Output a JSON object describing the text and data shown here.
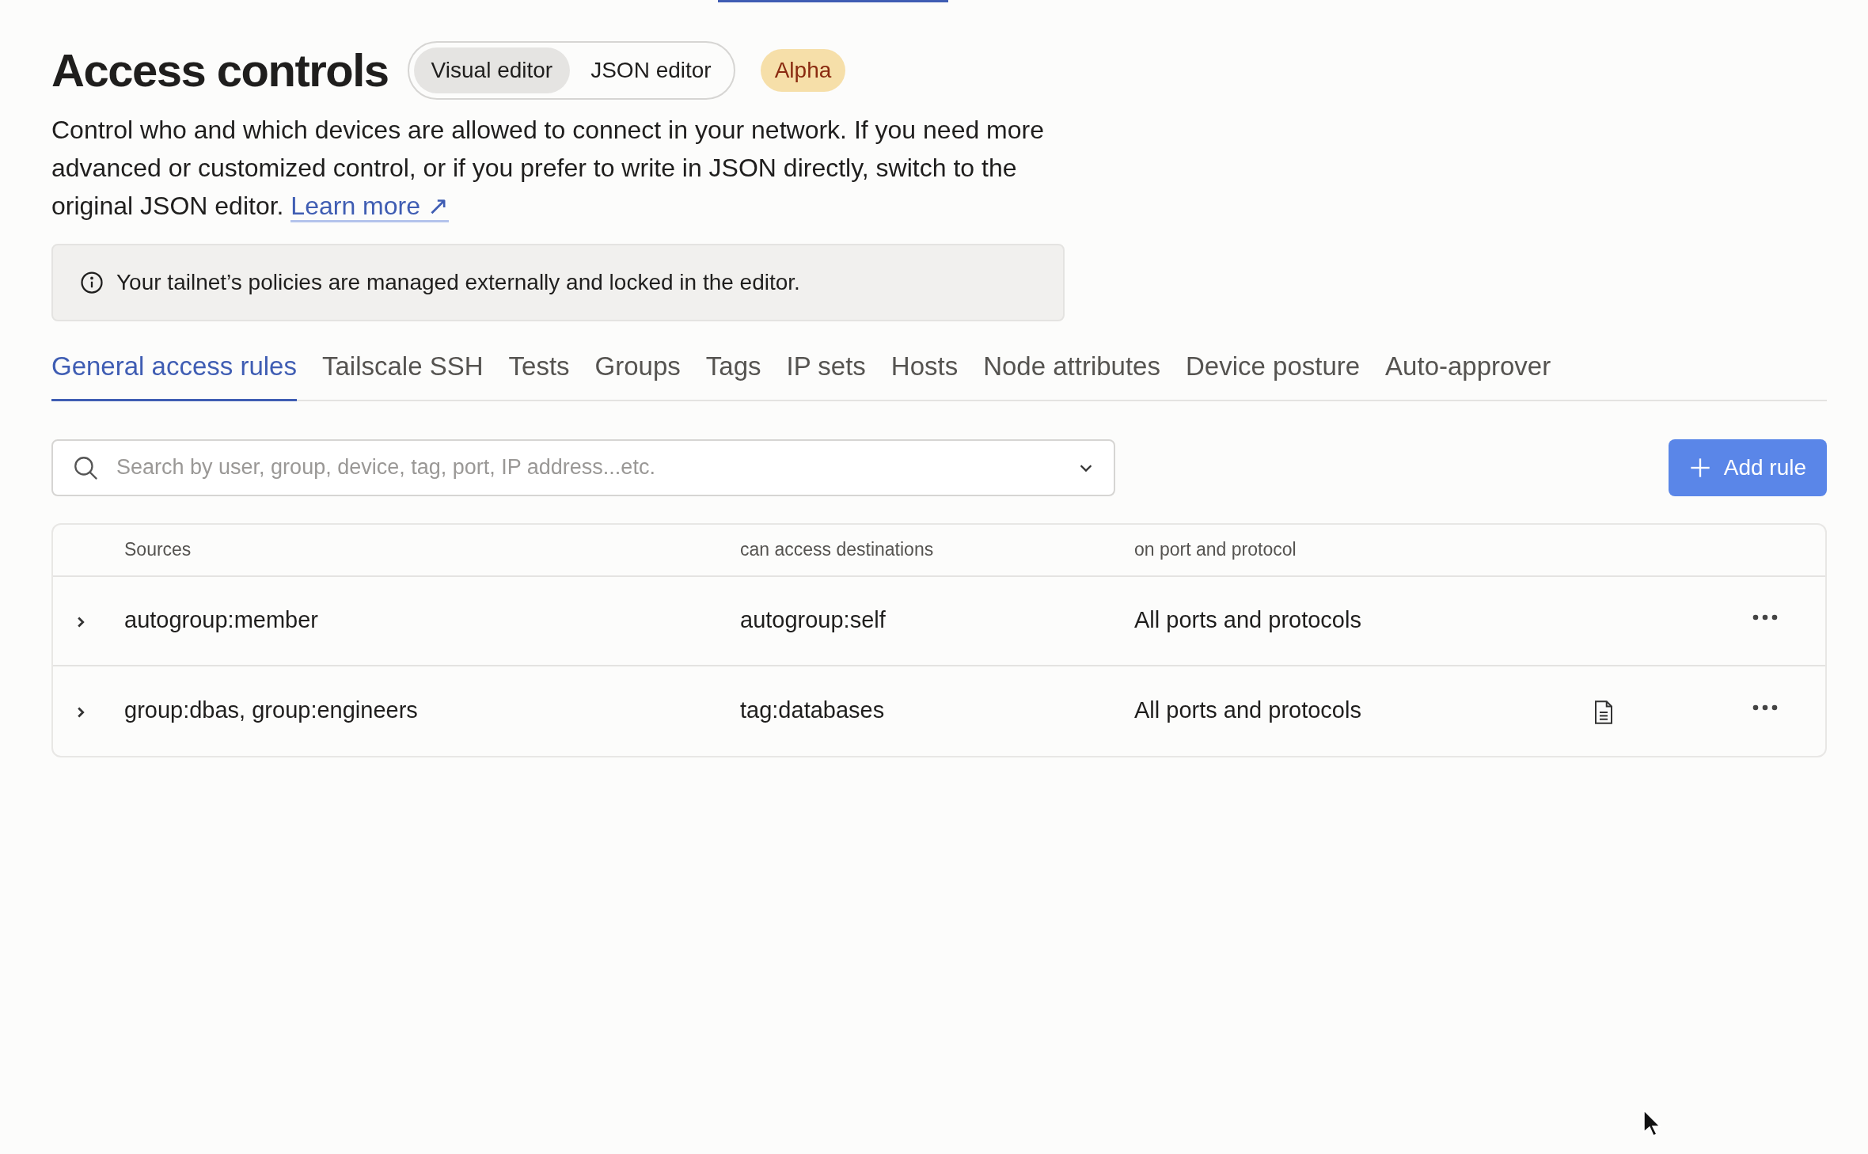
{
  "header": {
    "title": "Access controls",
    "editor_modes": [
      {
        "label": "Visual editor",
        "selected": true
      },
      {
        "label": "JSON editor",
        "selected": false
      }
    ],
    "badge": "Alpha"
  },
  "description": {
    "text": "Control who and which devices are allowed to connect in your network. If you need more advanced or customized control, or if you prefer to write in JSON directly, switch to the original JSON editor.",
    "link": "Learn more ↗"
  },
  "notice": "Your tailnet’s policies are managed externally and locked in the editor.",
  "tabs": [
    {
      "label": "General access rules",
      "selected": true
    },
    {
      "label": "Tailscale SSH",
      "selected": false
    },
    {
      "label": "Tests",
      "selected": false
    },
    {
      "label": "Groups",
      "selected": false
    },
    {
      "label": "Tags",
      "selected": false
    },
    {
      "label": "IP sets",
      "selected": false
    },
    {
      "label": "Hosts",
      "selected": false
    },
    {
      "label": "Node attributes",
      "selected": false
    },
    {
      "label": "Device posture",
      "selected": false
    },
    {
      "label": "Auto-approver",
      "selected": false
    }
  ],
  "search": {
    "placeholder": "Search by user, group, device, tag, port, IP address...etc."
  },
  "add_button": "Add rule",
  "table": {
    "columns": [
      "Sources",
      "can access destinations",
      "on port and protocol"
    ],
    "rows": [
      {
        "sources": "autogroup:member",
        "destinations": "autogroup:self",
        "ports": "All ports and protocols",
        "expanded": false,
        "has_document": false
      },
      {
        "sources": "group:dbas, group:engineers",
        "destinations": "tag:databases",
        "ports": "All ports and protocols",
        "expanded": false,
        "has_document": true
      }
    ]
  }
}
